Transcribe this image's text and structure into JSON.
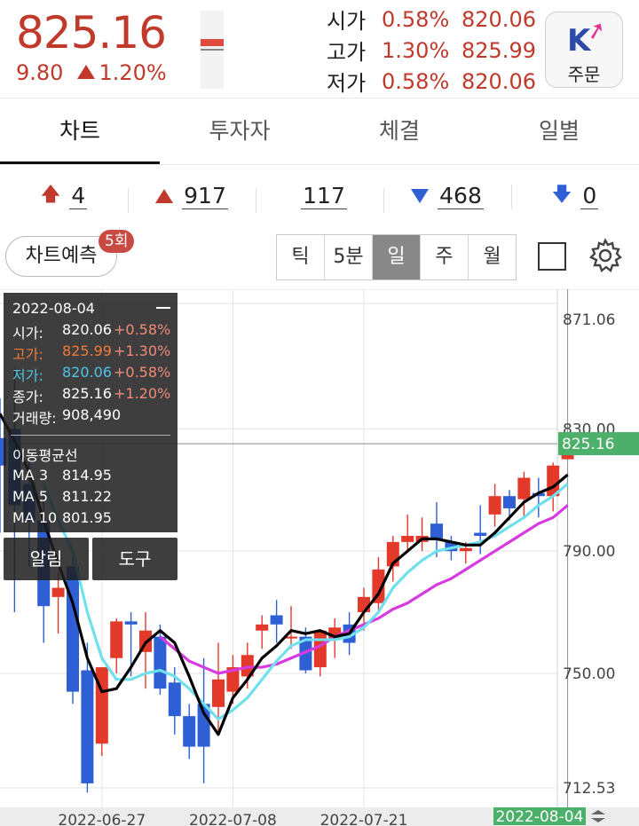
{
  "header": {
    "price": "825.16",
    "change": "9.80",
    "change_pct": "1.20%",
    "ohl": [
      {
        "label": "시가",
        "pct": "0.58%",
        "value": "820.06"
      },
      {
        "label": "고가",
        "pct": "1.30%",
        "value": "825.99"
      },
      {
        "label": "저가",
        "pct": "0.58%",
        "value": "820.06"
      }
    ],
    "order_button": {
      "logo": "K",
      "label": "주문"
    }
  },
  "tabs": [
    {
      "label": "차트",
      "active": true
    },
    {
      "label": "투자자",
      "active": false
    },
    {
      "label": "체결",
      "active": false
    },
    {
      "label": "일별",
      "active": false
    }
  ],
  "counts": [
    {
      "icon": "upper-limit-arrow-icon",
      "value": "4"
    },
    {
      "icon": "up-triangle-icon",
      "value": "917"
    },
    {
      "icon": "",
      "value": "117"
    },
    {
      "icon": "down-triangle-icon",
      "value": "468"
    },
    {
      "icon": "lower-limit-arrow-icon",
      "value": "0"
    }
  ],
  "toolbar": {
    "predict_label": "차트예측",
    "predict_badge": "5회",
    "periods": [
      "틱",
      "5분",
      "일",
      "주",
      "월"
    ],
    "active_period": "일"
  },
  "info_panel": {
    "date": "2022-08-04",
    "rows": [
      {
        "label": "시가:",
        "value": "820.06",
        "pct": "+0.58%",
        "color": "#ffffff"
      },
      {
        "label": "고가:",
        "value": "825.99",
        "pct": "+1.30%",
        "color": "#f07a3a"
      },
      {
        "label": "저가:",
        "value": "820.06",
        "pct": "+0.58%",
        "color": "#4fc3e8"
      },
      {
        "label": "종가:",
        "value": "825.16",
        "pct": "+1.20%",
        "color": "#ffffff"
      },
      {
        "label": "거래량:",
        "value": "908,490",
        "pct": "",
        "color": "#ffffff"
      }
    ],
    "ma_title": "이동평균선",
    "ma": [
      {
        "label": "MA 3",
        "value": "814.95"
      },
      {
        "label": "MA 5",
        "value": "811.22"
      },
      {
        "label": "MA 10",
        "value": "801.95"
      }
    ],
    "alert_label": "알림",
    "tools_label": "도구"
  },
  "chart_data": {
    "type": "candlestick",
    "y_ticks": [
      871.06,
      830.0,
      790.0,
      750.0,
      712.53
    ],
    "ylim": [
      712.53,
      871.06
    ],
    "x_ticks": [
      "2022-06-27",
      "2022-07-08",
      "2022-07-21"
    ],
    "current_date": "2022-08-04",
    "current_price": 825.16,
    "colors": {
      "up": "#e3392b",
      "down": "#2e5fd4",
      "ma3": "#000000",
      "ma5": "#6fe0ec",
      "ma10": "#d63ae0",
      "price_tag": "#4caf6a"
    },
    "candles": [
      {
        "o": 827,
        "h": 840,
        "l": 796,
        "c": 818
      },
      {
        "o": 830,
        "h": 850,
        "l": 770,
        "c": 805
      },
      {
        "o": 812,
        "h": 820,
        "l": 785,
        "c": 800
      },
      {
        "o": 800,
        "h": 808,
        "l": 760,
        "c": 772
      },
      {
        "o": 775,
        "h": 783,
        "l": 763,
        "c": 778
      },
      {
        "o": 785,
        "h": 788,
        "l": 740,
        "c": 744
      },
      {
        "o": 751,
        "h": 760,
        "l": 711,
        "c": 714
      },
      {
        "o": 727,
        "h": 752,
        "l": 723,
        "c": 752
      },
      {
        "o": 755,
        "h": 768,
        "l": 750,
        "c": 767
      },
      {
        "o": 767,
        "h": 770,
        "l": 749,
        "c": 766
      },
      {
        "o": 757,
        "h": 770,
        "l": 745,
        "c": 764
      },
      {
        "o": 762,
        "h": 766,
        "l": 743,
        "c": 745
      },
      {
        "o": 747,
        "h": 752,
        "l": 730,
        "c": 736
      },
      {
        "o": 736,
        "h": 740,
        "l": 722,
        "c": 726
      },
      {
        "o": 740,
        "h": 755,
        "l": 714,
        "c": 726
      },
      {
        "o": 739,
        "h": 760,
        "l": 730,
        "c": 748
      },
      {
        "o": 744,
        "h": 756,
        "l": 740,
        "c": 752
      },
      {
        "o": 749,
        "h": 760,
        "l": 745,
        "c": 756
      },
      {
        "o": 764,
        "h": 769,
        "l": 758,
        "c": 766
      },
      {
        "o": 769,
        "h": 774,
        "l": 760,
        "c": 766
      },
      {
        "o": 762,
        "h": 772,
        "l": 758,
        "c": 762
      },
      {
        "o": 762,
        "h": 765,
        "l": 750,
        "c": 751
      },
      {
        "o": 752,
        "h": 764,
        "l": 749,
        "c": 764
      },
      {
        "o": 761,
        "h": 768,
        "l": 755,
        "c": 765
      },
      {
        "o": 766,
        "h": 770,
        "l": 756,
        "c": 760
      },
      {
        "o": 770,
        "h": 778,
        "l": 764,
        "c": 775
      },
      {
        "o": 773,
        "h": 788,
        "l": 770,
        "c": 784
      },
      {
        "o": 785,
        "h": 795,
        "l": 780,
        "c": 793
      },
      {
        "o": 793,
        "h": 802,
        "l": 790,
        "c": 795
      },
      {
        "o": 793,
        "h": 801,
        "l": 790,
        "c": 795
      },
      {
        "o": 799,
        "h": 806,
        "l": 788,
        "c": 794
      },
      {
        "o": 793,
        "h": 795,
        "l": 787,
        "c": 790
      },
      {
        "o": 790,
        "h": 793,
        "l": 786,
        "c": 791
      },
      {
        "o": 796,
        "h": 805,
        "l": 789,
        "c": 795
      },
      {
        "o": 802,
        "h": 812,
        "l": 798,
        "c": 808
      },
      {
        "o": 808,
        "h": 810,
        "l": 800,
        "c": 804
      },
      {
        "o": 807,
        "h": 816,
        "l": 801,
        "c": 814
      },
      {
        "o": 809,
        "h": 814,
        "l": 801,
        "c": 808
      },
      {
        "o": 808,
        "h": 819,
        "l": 803,
        "c": 818
      },
      {
        "o": 820.06,
        "h": 825.99,
        "l": 820.06,
        "c": 825.16
      }
    ],
    "ma3": [
      835,
      826,
      816,
      800,
      786,
      773,
      755,
      744,
      745,
      752,
      760,
      764,
      760,
      749,
      737,
      730,
      742,
      748,
      755,
      759,
      764,
      763,
      764,
      762,
      763,
      770,
      776,
      786,
      790,
      794,
      794,
      793,
      792,
      792,
      796,
      801,
      806,
      809,
      811,
      815
    ],
    "ma5": [
      null,
      null,
      null,
      812,
      800,
      790,
      770,
      755,
      748,
      748,
      750,
      751,
      749,
      745,
      740,
      735,
      738,
      742,
      748,
      754,
      759,
      761,
      761,
      761,
      762,
      765,
      770,
      778,
      783,
      787,
      790,
      791,
      792,
      793,
      795,
      798,
      801,
      805,
      808,
      812
    ],
    "ma10": [
      null,
      null,
      null,
      null,
      null,
      null,
      null,
      null,
      null,
      null,
      null,
      762,
      758,
      754,
      752,
      750,
      751,
      752,
      752,
      753,
      755,
      757,
      759,
      762,
      764,
      766,
      768,
      771,
      773,
      776,
      779,
      781,
      784,
      787,
      790,
      793,
      796,
      799,
      801,
      805
    ]
  }
}
